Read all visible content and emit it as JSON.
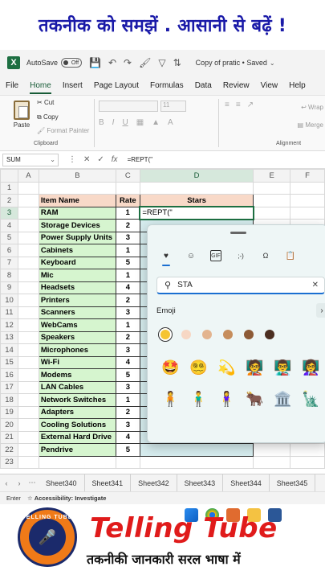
{
  "banner": {
    "text": "तकनीक को समझें . आसानी से बढ़ें !"
  },
  "titlebar": {
    "app_logo": "X",
    "autosave_label": "AutoSave",
    "autosave_state": "Off",
    "file_name": "Copy of pratic • Saved",
    "icons": [
      "save-icon",
      "undo-icon",
      "redo-icon",
      "format-painter-icon",
      "filter-icon",
      "sort-icon"
    ]
  },
  "menu": {
    "tabs": [
      "File",
      "Home",
      "Insert",
      "Page Layout",
      "Formulas",
      "Data",
      "Review",
      "View",
      "Help"
    ],
    "active": "Home"
  },
  "ribbon": {
    "paste_label": "Paste",
    "cut_label": "Cut",
    "copy_label": "Copy",
    "format_painter_label": "Format Painter",
    "clipboard_label": "Clipboard",
    "font_size": "11",
    "alignment_label": "Alignment",
    "wrap_label": "Wrap",
    "merge_label": "Merge"
  },
  "formula_bar": {
    "name_box": "SUM",
    "fx": "fx",
    "content": "=REPT(\""
  },
  "sheet": {
    "columns": [
      "A",
      "B",
      "C",
      "D",
      "E",
      "F"
    ],
    "header": {
      "row": "2",
      "item": "Item Name",
      "rate": "Rate",
      "stars": "Stars"
    },
    "active_cell_text": "=REPT(\"",
    "rows": [
      {
        "num": "3",
        "item": "RAM",
        "rate": "1"
      },
      {
        "num": "4",
        "item": "Storage Devices",
        "rate": "2"
      },
      {
        "num": "5",
        "item": "Power Supply Units",
        "rate": "3"
      },
      {
        "num": "6",
        "item": "Cabinets",
        "rate": "1"
      },
      {
        "num": "7",
        "item": "Keyboard",
        "rate": "5"
      },
      {
        "num": "8",
        "item": "Mic",
        "rate": "1"
      },
      {
        "num": "9",
        "item": "Headsets",
        "rate": "4"
      },
      {
        "num": "10",
        "item": "Printers",
        "rate": "2"
      },
      {
        "num": "11",
        "item": "Scanners",
        "rate": "3"
      },
      {
        "num": "12",
        "item": "WebCams",
        "rate": "1"
      },
      {
        "num": "13",
        "item": "Speakers",
        "rate": "2"
      },
      {
        "num": "14",
        "item": "Microphones",
        "rate": "3"
      },
      {
        "num": "15",
        "item": "Wi-Fi",
        "rate": "4"
      },
      {
        "num": "16",
        "item": "Modems",
        "rate": "5"
      },
      {
        "num": "17",
        "item": "LAN Cables",
        "rate": "3"
      },
      {
        "num": "18",
        "item": "Network Switches",
        "rate": "1"
      },
      {
        "num": "19",
        "item": "Adapters",
        "rate": "2"
      },
      {
        "num": "20",
        "item": "Cooling Solutions",
        "rate": "3"
      },
      {
        "num": "21",
        "item": "External Hard Drive",
        "rate": "4"
      },
      {
        "num": "22",
        "item": "Pendrive",
        "rate": "5"
      }
    ],
    "extra_row": "23"
  },
  "sheet_tabs": [
    "Sheet340",
    "Sheet341",
    "Sheet342",
    "Sheet343",
    "Sheet344",
    "Sheet345"
  ],
  "status": {
    "mode": "Enter",
    "accessibility": "Accessibility: Investigate"
  },
  "emoji_panel": {
    "tabs": [
      "emoji-tab-icon",
      "smiley-icon",
      "gif-icon",
      "kaomoji-icon",
      "symbols-icon",
      "clipboard-icon"
    ],
    "search_value": "STA",
    "section_label": "Emoji",
    "skin_tones": [
      "#f5c431",
      "#f7d7c4",
      "#e3b48f",
      "#c68d5c",
      "#8d5a36",
      "#4b2e20"
    ],
    "emojis": [
      "🤩",
      "😵‍💫",
      "💫",
      "🧑‍🏫",
      "👨‍🏫",
      "👩‍🏫",
      "🧍",
      "🧍‍♂️",
      "🧍‍♀️",
      "🐂",
      "🏛️",
      "🗽"
    ]
  },
  "brand": {
    "logo_text": "TELLING TUBE",
    "title": "Telling Tube",
    "subtitle": "तकनीकी जानकारी सरल भाषा में"
  }
}
